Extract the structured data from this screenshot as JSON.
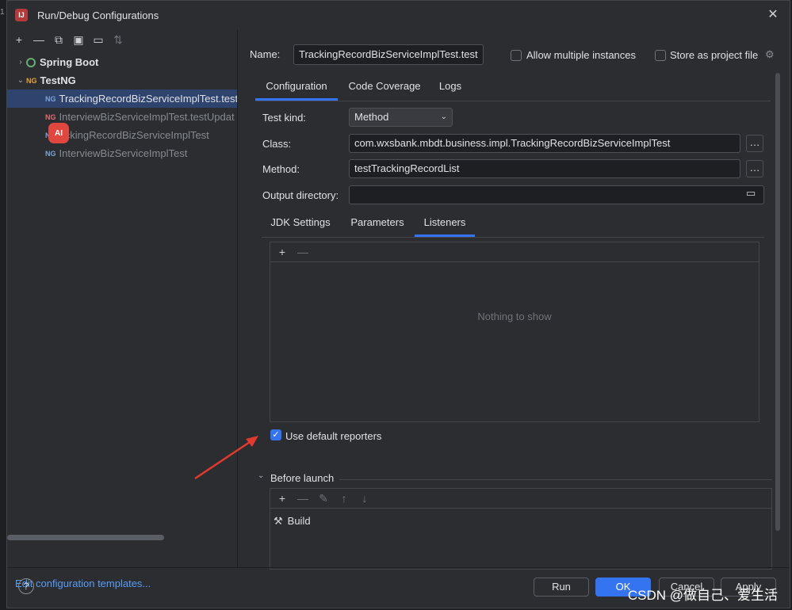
{
  "window": {
    "title": "Run/Debug Configurations",
    "app_icon": "intellij-icon"
  },
  "left": {
    "toolbar": [
      "add-icon",
      "remove-icon",
      "copy-icon",
      "save-icon",
      "folder-icon",
      "sort-icon"
    ],
    "tree": [
      {
        "label": "Spring Boot",
        "level": 0,
        "expanded": false,
        "icon": "spring-boot-icon"
      },
      {
        "label": "TestNG",
        "level": 0,
        "expanded": true,
        "icon": "testng-icon"
      },
      {
        "label": "TrackingRecordBizServiceImplTest.test",
        "level": 1,
        "selected": true,
        "icon": "testng-icon"
      },
      {
        "label": "InterviewBizServiceImplTest.testUpdat",
        "level": 1,
        "icon": "testng-error-icon"
      },
      {
        "label": "TrackingRecordBizServiceImplTest",
        "visible_label": "ackingRecordBizServiceImplTest",
        "level": 1,
        "icon": "testng-icon"
      },
      {
        "label": "InterviewBizServiceImplTest",
        "level": 1,
        "icon": "testng-icon"
      }
    ],
    "edit_templates": "Edit configuration templates..."
  },
  "form": {
    "name_label": "Name:",
    "name_value": "TrackingRecordBizServiceImplTest.test",
    "allow_multiple": "Allow multiple instances",
    "store_project": "Store as project file",
    "tabs": [
      "Configuration",
      "Code Coverage",
      "Logs"
    ],
    "test_kind_label": "Test kind:",
    "test_kind_value": "Method",
    "class_label": "Class:",
    "class_value": "com.wxsbank.mbdt.business.impl.TrackingRecordBizServiceImplTest",
    "method_label": "Method:",
    "method_value": "testTrackingRecordList",
    "output_label": "Output directory:",
    "output_value": "",
    "subtabs": [
      "JDK Settings",
      "Parameters",
      "Listeners"
    ],
    "listeners_empty": "Nothing to show",
    "use_default_reporters": "Use default reporters",
    "use_default_checked": true,
    "before_launch": "Before launch",
    "build_item": "Build"
  },
  "footer": {
    "help": "?",
    "run": "Run",
    "ok": "OK",
    "cancel": "Cancel",
    "apply": "Apply"
  },
  "watermark": "CSDN @做自己、爱生活",
  "colors": {
    "accent": "#3574f0",
    "background": "#2b2d30",
    "arrow": "#e03a2f"
  }
}
